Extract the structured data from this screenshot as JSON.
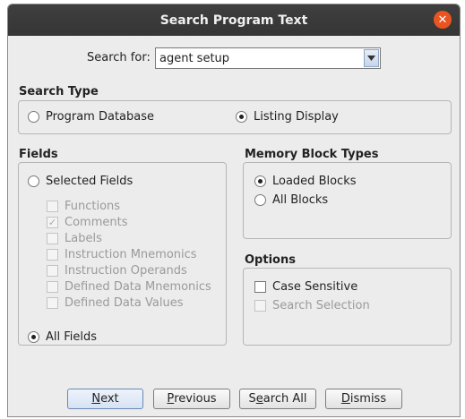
{
  "window": {
    "title": "Search Program Text"
  },
  "search": {
    "label": "Search for:",
    "value": "agent setup"
  },
  "search_type": {
    "title": "Search Type",
    "options": [
      {
        "label": "Program Database",
        "selected": false
      },
      {
        "label": "Listing Display",
        "selected": true
      }
    ]
  },
  "fields": {
    "title": "Fields",
    "selected_fields_label": "Selected Fields",
    "items": [
      {
        "label": "Functions",
        "checked": false
      },
      {
        "label": "Comments",
        "checked": true
      },
      {
        "label": "Labels",
        "checked": false
      },
      {
        "label": "Instruction Mnemonics",
        "checked": false
      },
      {
        "label": "Instruction Operands",
        "checked": false
      },
      {
        "label": "Defined Data Mnemonics",
        "checked": false
      },
      {
        "label": "Defined Data Values",
        "checked": false
      }
    ],
    "all_fields_label": "All Fields"
  },
  "memory_block_types": {
    "title": "Memory Block Types",
    "options": [
      {
        "label": "Loaded Blocks",
        "selected": true
      },
      {
        "label": "All Blocks",
        "selected": false
      }
    ]
  },
  "options": {
    "title": "Options",
    "case_sensitive_label": "Case Sensitive",
    "search_selection_label": "Search Selection"
  },
  "buttons": {
    "next_first": "N",
    "next_rest": "ext",
    "previous_first": "P",
    "previous_rest": "revious",
    "search_all_first": "S",
    "search_all_u": "e",
    "search_all_rest": "arch All",
    "dismiss_first": "D",
    "dismiss_rest": "ismiss"
  }
}
